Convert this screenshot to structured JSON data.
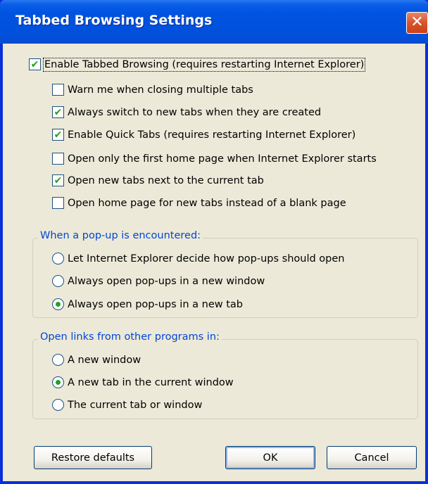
{
  "window": {
    "title": "Tabbed Browsing Settings",
    "close_glyph": "✕"
  },
  "main_checkbox": {
    "label": "Enable Tabbed Browsing (requires restarting Internet Explorer)",
    "checked": true
  },
  "options": [
    {
      "label": "Warn me when closing multiple tabs",
      "checked": false
    },
    {
      "label": "Always switch to new tabs when they are created",
      "checked": true
    },
    {
      "label": "Enable Quick Tabs (requires restarting Internet Explorer)",
      "checked": true
    },
    {
      "label": "Open only the first home page when Internet Explorer starts",
      "checked": false
    },
    {
      "label": "Open new tabs next to the current tab",
      "checked": true
    },
    {
      "label": "Open home page for new tabs instead of a blank page",
      "checked": false
    }
  ],
  "popup_group": {
    "title": "When a pop-up is encountered:",
    "options": [
      {
        "label": "Let Internet Explorer decide how pop-ups should open",
        "selected": false
      },
      {
        "label": "Always open pop-ups in a new window",
        "selected": false
      },
      {
        "label": "Always open pop-ups in a new tab",
        "selected": true
      }
    ]
  },
  "links_group": {
    "title": "Open links from other programs in:",
    "options": [
      {
        "label": "A new window",
        "selected": false
      },
      {
        "label": "A new tab in the current window",
        "selected": true
      },
      {
        "label": "The current tab or window",
        "selected": false
      }
    ]
  },
  "buttons": {
    "restore": "Restore defaults",
    "ok": "OK",
    "cancel": "Cancel"
  },
  "check_glyph": "✔"
}
